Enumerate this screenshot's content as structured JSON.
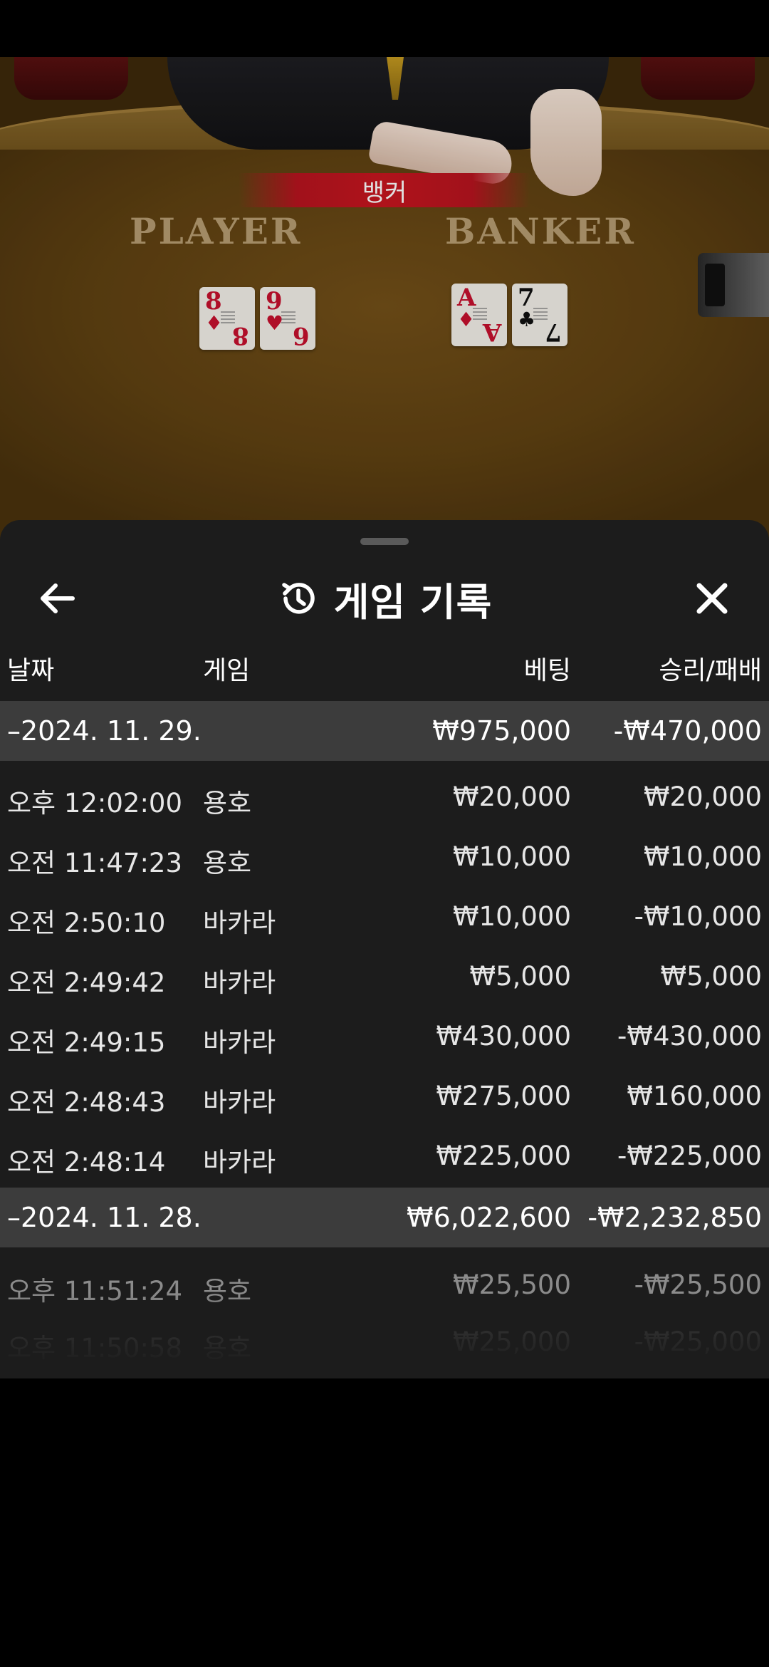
{
  "video": {
    "result_banner": "뱅커",
    "player_label": "PLAYER",
    "banker_label": "BANKER",
    "player_cards": [
      {
        "rank": "8",
        "suit": "♦",
        "color": "red"
      },
      {
        "rank": "9",
        "rank2": "6",
        "suit": "♥",
        "color": "red"
      }
    ],
    "banker_cards": [
      {
        "rank": "A",
        "suit": "♦",
        "color": "red"
      },
      {
        "rank": "7",
        "suit": "♣",
        "color": "black"
      }
    ]
  },
  "sheet": {
    "title": "게임 기록",
    "icons": {
      "back": "back-arrow-icon",
      "history": "history-icon",
      "close": "close-icon"
    },
    "columns": {
      "date": "날짜",
      "game": "게임",
      "bet": "베팅",
      "result": "승리/패배"
    },
    "groups": [
      {
        "date": "–2024. 11. 29.",
        "bet_total": "₩975,000",
        "result_total": "-₩470,000",
        "rows": [
          {
            "time": "오후 12:02:00",
            "game": "용호",
            "bet": "₩20,000",
            "result": "₩20,000"
          },
          {
            "time": "오전 11:47:23",
            "game": "용호",
            "bet": "₩10,000",
            "result": "₩10,000"
          },
          {
            "time": "오전 2:50:10",
            "game": "바카라",
            "bet": "₩10,000",
            "result": "-₩10,000"
          },
          {
            "time": "오전 2:49:42",
            "game": "바카라",
            "bet": "₩5,000",
            "result": "₩5,000"
          },
          {
            "time": "오전 2:49:15",
            "game": "바카라",
            "bet": "₩430,000",
            "result": "-₩430,000"
          },
          {
            "time": "오전 2:48:43",
            "game": "바카라",
            "bet": "₩275,000",
            "result": "₩160,000"
          },
          {
            "time": "오전 2:48:14",
            "game": "바카라",
            "bet": "₩225,000",
            "result": "-₩225,000"
          }
        ]
      },
      {
        "date": "–2024. 11. 28.",
        "bet_total": "₩6,022,600",
        "result_total": "-₩2,232,850",
        "rows": [
          {
            "time": "오후 11:51:24",
            "game": "용호",
            "bet": "₩25,500",
            "result": "-₩25,500"
          },
          {
            "time": "오후 11:50:58",
            "game": "용호",
            "bet": "₩25,000",
            "result": "-₩25,000"
          }
        ]
      }
    ]
  },
  "colors": {
    "sheet_bg": "#1c1c1c",
    "group_bg": "#3c3c3c",
    "banner_red": "#c8161f"
  }
}
